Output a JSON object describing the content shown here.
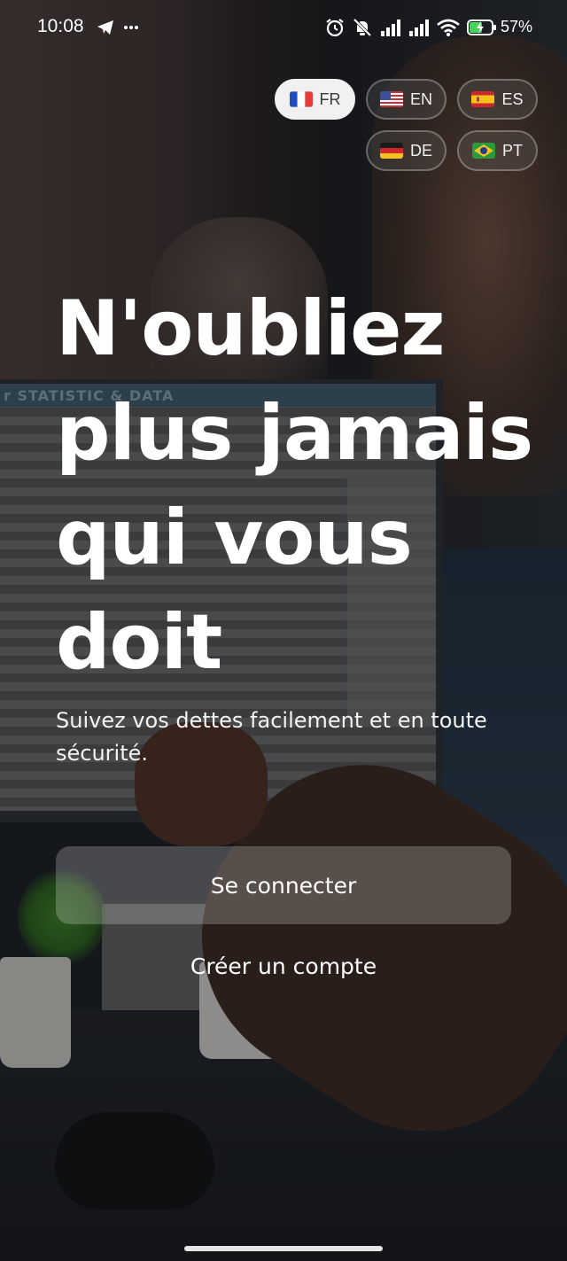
{
  "status_bar": {
    "time": "10:08",
    "battery_percent": "57%",
    "icons": [
      "telegram-icon",
      "more-icon",
      "alarm-icon",
      "mute-icon",
      "signal-icon",
      "signal-icon",
      "wifi-icon",
      "battery-charging-icon"
    ]
  },
  "languages": [
    {
      "code": "FR",
      "flag": "france",
      "active": true
    },
    {
      "code": "EN",
      "flag": "usa",
      "active": false
    },
    {
      "code": "ES",
      "flag": "spain",
      "active": false
    },
    {
      "code": "DE",
      "flag": "germany",
      "active": false
    },
    {
      "code": "PT",
      "flag": "brazil",
      "active": false
    }
  ],
  "hero": {
    "headline_lines": [
      "N'oubliez",
      "plus jamais",
      "qui vous",
      "doit"
    ],
    "subtitle": "Suivez vos dettes facilement et en toute sécurité."
  },
  "actions": {
    "login_label": "Se connecter",
    "create_account_label": "Créer un compte"
  },
  "background_text": "r STATISTIC & DATA",
  "colors": {
    "button_bg": "rgba(255,255,255,0.22)",
    "active_chip_bg": "#f1f1f1",
    "text": "#ffffff"
  }
}
